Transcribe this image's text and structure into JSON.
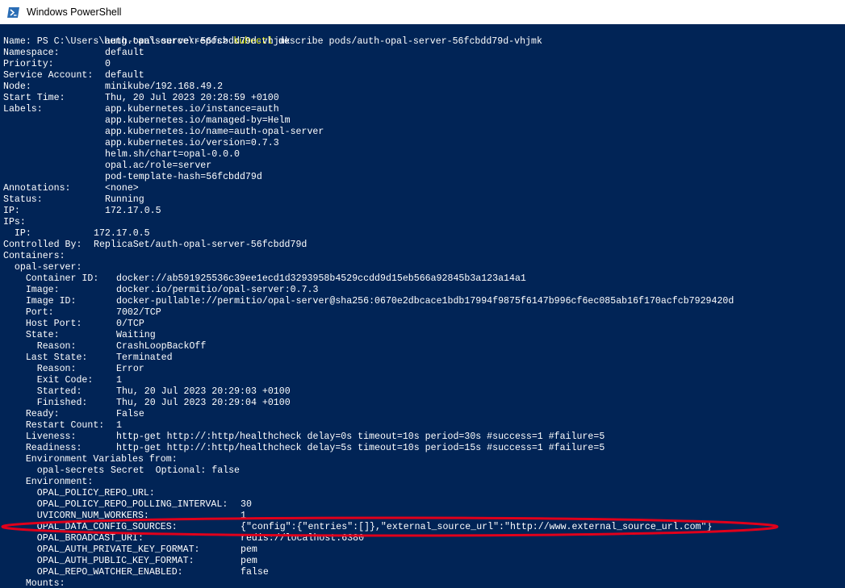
{
  "window": {
    "title": "Windows PowerShell",
    "icon": "powershell-icon"
  },
  "colors": {
    "terminal_bg": "#012456",
    "terminal_fg": "#ffffff",
    "command_fg": "#ffff00",
    "annotation": "#e0001b"
  },
  "prompt": {
    "path": "PS C:\\Users\\heng.tan\\source\\repos> ",
    "cmd": "kubectl",
    "args": " describe pods/auth-opal-server-56fcbdd79d-vhjmk"
  },
  "output_lines": [
    {
      "k": "Name:",
      "v": "auth-opal-server-56fcbdd79d-vhjmk"
    },
    {
      "k": "Namespace:",
      "v": "default"
    },
    {
      "k": "Priority:",
      "v": "0"
    },
    {
      "k": "Service Account:",
      "v": "default"
    },
    {
      "k": "Node:",
      "v": "minikube/192.168.49.2"
    },
    {
      "k": "Start Time:",
      "v": "Thu, 20 Jul 2023 20:28:59 +0100"
    },
    {
      "k": "Labels:",
      "v": "app.kubernetes.io/instance=auth"
    },
    {
      "k": "",
      "v": "app.kubernetes.io/managed-by=Helm"
    },
    {
      "k": "",
      "v": "app.kubernetes.io/name=auth-opal-server"
    },
    {
      "k": "",
      "v": "app.kubernetes.io/version=0.7.3"
    },
    {
      "k": "",
      "v": "helm.sh/chart=opal-0.0.0"
    },
    {
      "k": "",
      "v": "opal.ac/role=server"
    },
    {
      "k": "",
      "v": "pod-template-hash=56fcbdd79d"
    },
    {
      "k": "Annotations:",
      "v": "<none>"
    },
    {
      "k": "Status:",
      "v": "Running"
    },
    {
      "k": "IP:",
      "v": "172.17.0.5"
    },
    {
      "k": "IPs:",
      "v": ""
    },
    {
      "k": "  IP:",
      "v": "172.17.0.5"
    },
    {
      "k": "Controlled By:",
      "v": "ReplicaSet/auth-opal-server-56fcbdd79d"
    },
    {
      "k": "Containers:",
      "v": ""
    },
    {
      "k": "  opal-server:",
      "v": ""
    },
    {
      "k": "    Container ID:",
      "v": "docker://ab591925536c39ee1ecd1d3293958b4529ccdd9d15eb566a92845b3a123a14a1"
    },
    {
      "k": "    Image:",
      "v": "docker.io/permitio/opal-server:0.7.3"
    },
    {
      "k": "    Image ID:",
      "v": "docker-pullable://permitio/opal-server@sha256:0670e2dbcace1bdb17994f9875f6147b996cf6ec085ab16f170acfcb7929420d"
    },
    {
      "k": "    Port:",
      "v": "7002/TCP"
    },
    {
      "k": "    Host Port:",
      "v": "0/TCP"
    },
    {
      "k": "    State:",
      "v": "Waiting"
    },
    {
      "k": "      Reason:",
      "v": "CrashLoopBackOff"
    },
    {
      "k": "    Last State:",
      "v": "Terminated"
    },
    {
      "k": "      Reason:",
      "v": "Error"
    },
    {
      "k": "      Exit Code:",
      "v": "1"
    },
    {
      "k": "      Started:",
      "v": "Thu, 20 Jul 2023 20:29:03 +0100"
    },
    {
      "k": "      Finished:",
      "v": "Thu, 20 Jul 2023 20:29:04 +0100"
    },
    {
      "k": "    Ready:",
      "v": "False"
    },
    {
      "k": "    Restart Count:",
      "v": "1"
    },
    {
      "k": "    Liveness:",
      "v": "http-get http://:http/healthcheck delay=0s timeout=10s period=30s #success=1 #failure=5"
    },
    {
      "k": "    Readiness:",
      "v": "http-get http://:http/healthcheck delay=5s timeout=10s period=15s #success=1 #failure=5"
    },
    {
      "k": "    Environment Variables from:",
      "v": ""
    },
    {
      "k": "      opal-secrets",
      "v": "Secret  Optional: false"
    },
    {
      "k": "    Environment:",
      "v": ""
    },
    {
      "k": "      OPAL_POLICY_REPO_URL:",
      "v": ""
    },
    {
      "k": "      OPAL_POLICY_REPO_POLLING_INTERVAL:",
      "v": "30"
    },
    {
      "k": "      UVICORN_NUM_WORKERS:",
      "v": "1"
    },
    {
      "k": "      OPAL_DATA_CONFIG_SOURCES:",
      "v": "{\"config\":{\"entries\":[]},\"external_source_url\":\"http://www.external_source_url.com\"}"
    },
    {
      "k": "      OPAL_BROADCAST_URI:",
      "v": "redis://localhost:6380"
    },
    {
      "k": "      OPAL_AUTH_PRIVATE_KEY_FORMAT:",
      "v": "pem"
    },
    {
      "k": "      OPAL_AUTH_PUBLIC_KEY_FORMAT:",
      "v": "pem"
    },
    {
      "k": "      OPAL_REPO_WATCHER_ENABLED:",
      "v": "false"
    },
    {
      "k": "    Mounts:",
      "v": ""
    }
  ]
}
